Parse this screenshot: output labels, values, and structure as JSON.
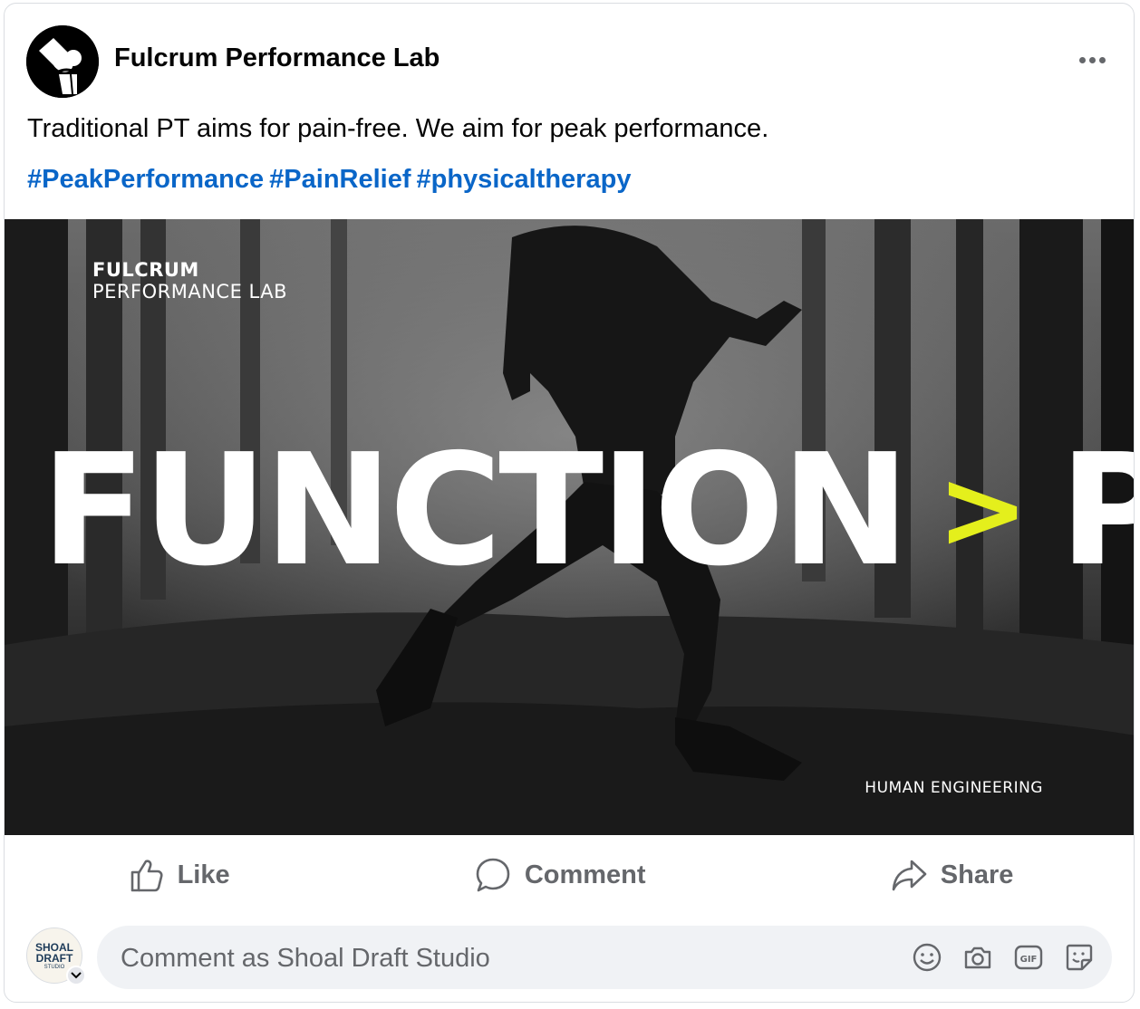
{
  "post": {
    "page_name": "Fulcrum Performance Lab",
    "text": "Traditional PT aims for pain-free. We aim for peak performance.",
    "hashtags": [
      "#PeakPerformance",
      "#PainRelief",
      "#physicaltherapy"
    ]
  },
  "image": {
    "brand_line1": "FULCRUM",
    "brand_line2": "PERFORMANCE LAB",
    "headline_left": "FUNCTION",
    "headline_symbol": ">",
    "headline_right": "PAIN",
    "tagline": "HUMAN ENGINEERING",
    "accent_color": "#e4ef1c"
  },
  "actions": {
    "like": "Like",
    "comment": "Comment",
    "share": "Share"
  },
  "comment_bar": {
    "placeholder": "Comment as Shoal Draft Studio",
    "avatar_line1": "SHOAL",
    "avatar_line2": "DRAFT",
    "avatar_line3": "STUDIO",
    "tools": [
      "emoji-icon",
      "camera-icon",
      "gif-icon",
      "sticker-icon"
    ]
  },
  "colors": {
    "link": "#0a66c8",
    "muted": "#65676b",
    "input_bg": "#f0f2f5"
  }
}
